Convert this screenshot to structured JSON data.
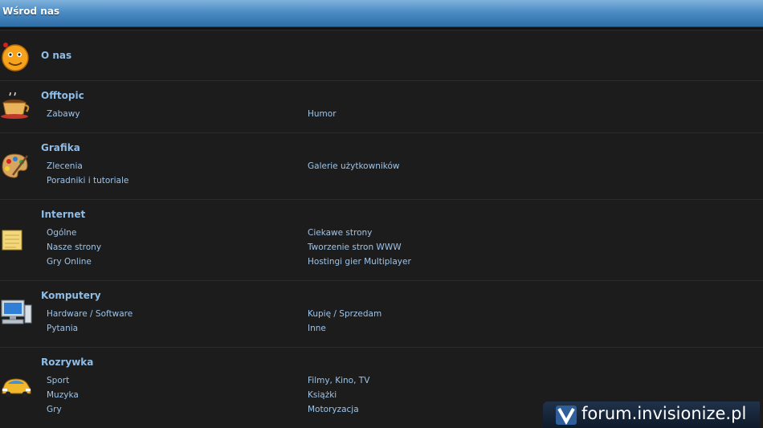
{
  "header": {
    "title": "Wśrod nas"
  },
  "categories": [
    {
      "name": "O nas",
      "icon": "emoticon-icon",
      "subforums": []
    },
    {
      "name": "Offtopic",
      "icon": "coffee-cup-icon",
      "subforums": [
        "Zabawy",
        "Humor"
      ]
    },
    {
      "name": "Grafika",
      "icon": "paint-palette-icon",
      "subforums": [
        "Zlecenia",
        "Galerie użytkowników",
        "Poradniki i tutoriale"
      ]
    },
    {
      "name": "Internet",
      "icon": "notepad-icon",
      "subforums": [
        "Ogólne",
        "Ciekawe strony",
        "Nasze strony",
        "Tworzenie stron WWW",
        "Gry Online",
        "Hostingi gier Multiplayer"
      ]
    },
    {
      "name": "Komputery",
      "icon": "computer-icon",
      "subforums": [
        "Hardware / Software",
        "Kupię / Sprzedam",
        "Pytania",
        "Inne"
      ]
    },
    {
      "name": "Rozrywka",
      "icon": "car-icon",
      "subforums": [
        "Sport",
        "Filmy, Kino, TV",
        "Muzyka",
        "Książki",
        "Gry",
        "Motoryzacja"
      ]
    }
  ],
  "watermark": {
    "text": "forum.invisionize.pl",
    "icon": "v-logo-icon"
  },
  "colors": {
    "header": "#4c8cc4",
    "row_background": "#1c1c1d",
    "link": "#9ec4e8",
    "category_title": "#8fbde6"
  }
}
